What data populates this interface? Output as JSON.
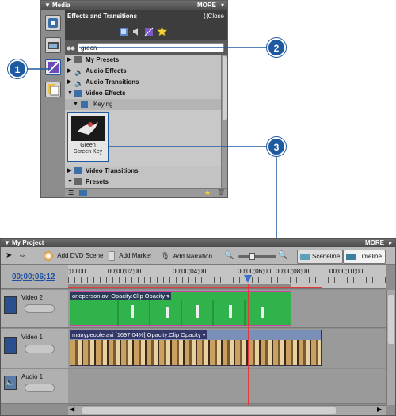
{
  "media": {
    "title": "Media",
    "more": "MORE",
    "effects_header": "Effects and Transitions",
    "close_label": "Close",
    "search_value": "green",
    "tree": [
      {
        "label": "My Presets"
      },
      {
        "label": "Audio Effects"
      },
      {
        "label": "Audio Transitions"
      },
      {
        "label": "Video Effects"
      },
      {
        "label": "Keying"
      },
      {
        "label": "Video Transitions"
      },
      {
        "label": "Presets"
      }
    ],
    "effect_tile_label_line1": "Green",
    "effect_tile_label_line2": "Screen Key"
  },
  "callouts": [
    "1",
    "2",
    "3"
  ],
  "project": {
    "title": "My Project",
    "more": "MORE",
    "toolbar": {
      "add_dvd_scene": "Add DVD Scene",
      "add_marker": "Add Marker",
      "add_narration": "Add Narration",
      "sceneline": "Sceneline",
      "timeline": "Timeline"
    },
    "timecode": "00;00;06;12",
    "ruler_ticks": [
      ";00;00",
      "00;00;02;00",
      "00;00;04;00",
      "00;00;06;00",
      "00;00;08;00",
      "00;00;10;00"
    ],
    "tracks": [
      {
        "name": "Video 2",
        "clip_label": "oneperson.avi  Opacity:Clip Opacity ▾"
      },
      {
        "name": "Video 1",
        "clip_label": "manypeople.avi [1697.04%]  Opacity:Clip Opacity ▾"
      },
      {
        "name": "Audio 1"
      }
    ]
  },
  "colors": {
    "accent_blue": "#1e5aa0",
    "clip_green": "#2fb34a",
    "playhead_red": "#e23a3a",
    "panel_dark": "#3d3d3d"
  }
}
